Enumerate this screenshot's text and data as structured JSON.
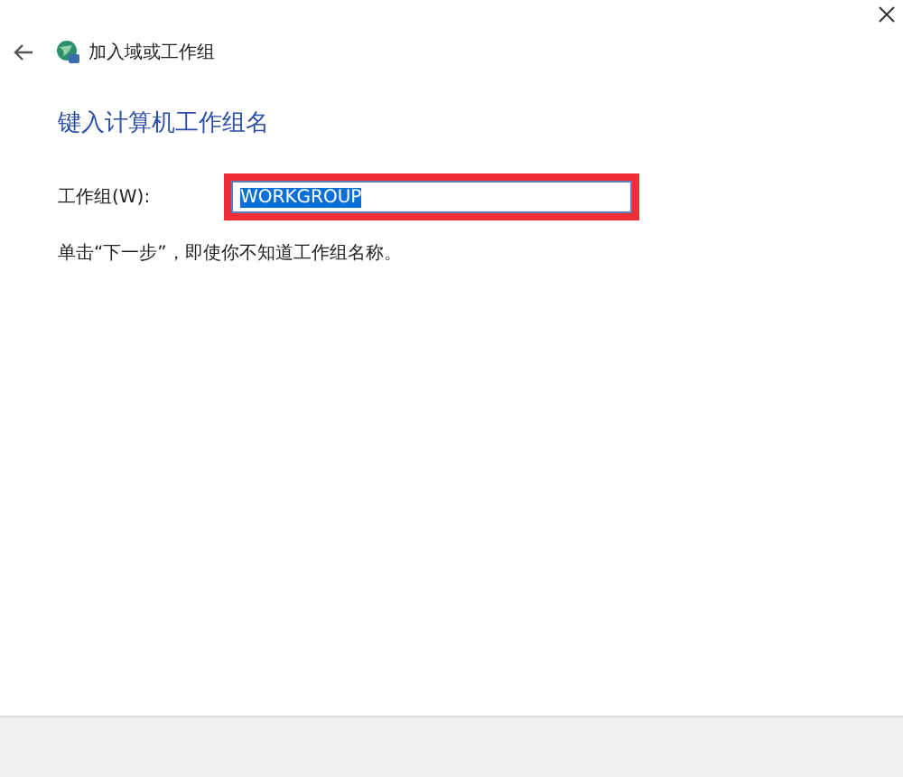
{
  "window": {
    "title": "加入域或工作组"
  },
  "heading": "键入计算机工作组名",
  "workgroup_field": {
    "label": "工作组(W):",
    "value": "WORKGROUP",
    "value_selected": true,
    "highlighted": true
  },
  "hint": "单击“下一步”，即使你不知道工作组名称。"
}
